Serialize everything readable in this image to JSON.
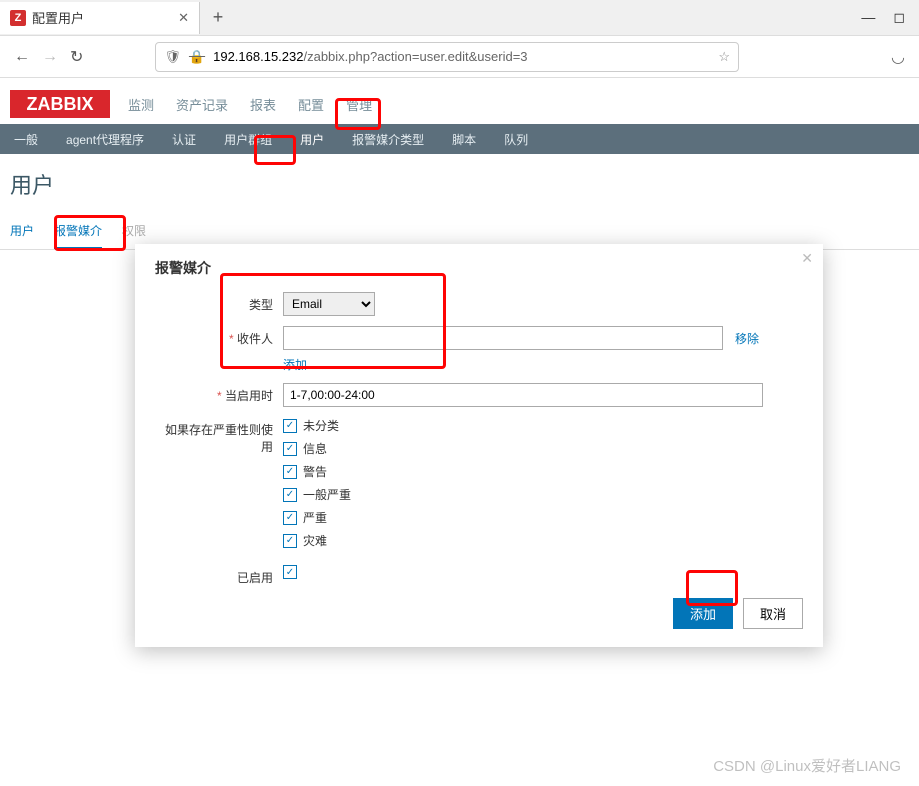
{
  "browser": {
    "tab_title": "配置用户",
    "url_prefix": "192.168.15.232",
    "url_path": "/zabbix.php?action=user.edit&userid=3"
  },
  "topnav": {
    "items": [
      "监测",
      "资产记录",
      "报表",
      "配置",
      "管理"
    ]
  },
  "subnav": {
    "items": [
      "一般",
      "agent代理程序",
      "认证",
      "用户群组",
      "用户",
      "报警媒介类型",
      "脚本",
      "队列"
    ]
  },
  "page": {
    "title": "用户"
  },
  "tabs": {
    "items": [
      "用户",
      "报警媒介",
      "权限"
    ]
  },
  "modal": {
    "title": "报警媒介",
    "type_label": "类型",
    "type_value": "Email",
    "recipient_label": "收件人",
    "recipient_value": "",
    "remove_label": "移除",
    "add_link": "添加",
    "when_label": "当启用时",
    "when_value": "1-7,00:00-24:00",
    "severity_label": "如果存在严重性则使用",
    "severities": [
      "未分类",
      "信息",
      "警告",
      "一般严重",
      "严重",
      "灾难"
    ],
    "enabled_label": "已启用",
    "btn_add": "添加",
    "btn_cancel": "取消"
  },
  "watermark": "CSDN @Linux爱好者LIANG"
}
